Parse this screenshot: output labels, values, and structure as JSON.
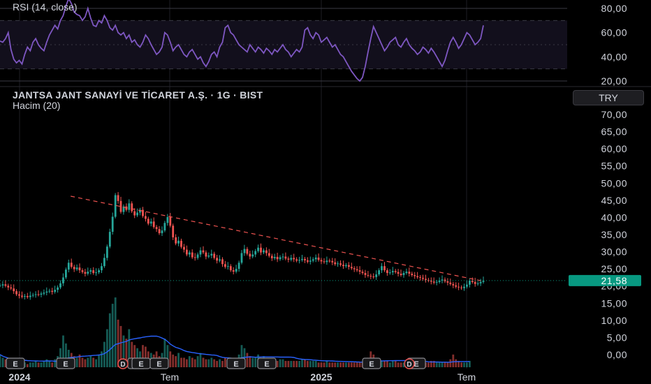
{
  "header": {
    "symbol_title": "JANTSA JANT SANAYİ VE TİCARET A.Ş. · 1G · BIST",
    "volume_label": "Hacim (20)",
    "rsi_label": "RSI (14, close)",
    "currency_button": "TRY"
  },
  "colors": {
    "background": "#000000",
    "rsi_line": "#7e57c2",
    "rsi_band": "#120f1c",
    "up": "#26a69a",
    "down": "#ef5350",
    "trendline": "#ef5350",
    "price_badge": "#089981",
    "volume_ma": "#2962ff"
  },
  "chart_data": [
    {
      "type": "line",
      "title": "RSI (14, close)",
      "yticks": [
        "80,00",
        "60,00",
        "40,00",
        "20,00"
      ],
      "ylim": [
        20,
        80
      ],
      "bands": [
        30,
        70
      ],
      "series": [
        {
          "values": [
            53,
            52,
            55,
            60,
            46,
            38,
            35,
            37,
            34,
            42,
            48,
            45,
            52,
            55,
            50,
            47,
            45,
            52,
            58,
            62,
            66,
            63,
            70,
            74,
            82,
            88,
            84,
            77,
            75,
            74,
            70,
            73,
            80,
            72,
            66,
            65,
            70,
            68,
            74,
            70,
            64,
            62,
            66,
            60,
            58,
            60,
            55,
            58,
            52,
            54,
            50,
            48,
            52,
            58,
            55,
            50,
            46,
            42,
            44,
            48,
            60,
            58,
            52,
            45,
            48,
            50,
            46,
            42,
            40,
            44,
            46,
            42,
            38,
            40,
            35,
            32,
            36,
            42,
            44,
            40,
            48,
            52,
            64,
            66,
            60,
            58,
            54,
            50,
            48,
            46,
            44,
            50,
            47,
            44,
            48,
            46,
            43,
            47,
            45,
            42,
            46,
            44,
            47,
            50,
            46,
            44,
            40,
            43,
            46,
            44,
            48,
            62,
            64,
            58,
            55,
            60,
            58,
            52,
            54,
            56,
            52,
            48,
            50,
            46,
            42,
            40,
            36,
            32,
            28,
            25,
            22,
            20,
            23,
            32,
            44,
            55,
            65,
            60,
            55,
            50,
            45,
            48,
            52,
            54,
            56,
            50,
            48,
            52,
            55,
            50,
            47,
            45,
            42,
            44,
            48,
            46,
            43,
            47,
            44,
            40,
            36,
            32,
            37,
            45,
            52,
            56,
            52,
            47,
            50,
            55,
            60,
            58,
            54,
            50,
            52,
            55,
            66
          ]
        }
      ]
    },
    {
      "type": "candlestick",
      "title": "JANTSA JANT SANAYİ VE TİCARET A.Ş. · 1G · BIST",
      "yticks": [
        "70,00",
        "65,00",
        "60,00",
        "55,00",
        "50,00",
        "45,00",
        "40,00",
        "35,00",
        "30,00",
        "25,00",
        "20,00",
        "15,00",
        "10,00",
        "5,00",
        "0,00"
      ],
      "ylim": [
        0,
        70
      ],
      "xticks": [
        "2024",
        "Tem",
        "2025",
        "Tem"
      ],
      "last_price": "21,58",
      "close": [
        20.2,
        20.5,
        20.1,
        19.6,
        19.3,
        18.5,
        17.6,
        17.2,
        16.9,
        17.1,
        16.8,
        17.2,
        17.4,
        17.6,
        17.5,
        17.8,
        18.1,
        18.4,
        18.6,
        18.3,
        18.9,
        19.6,
        20.8,
        22.5,
        24.8,
        26.8,
        25.6,
        24.9,
        25.4,
        24.6,
        24.1,
        23.6,
        24.2,
        24.6,
        23.8,
        24.0,
        24.6,
        25.8,
        28.2,
        31.5,
        35.8,
        40.2,
        46.5,
        44.8,
        41.6,
        43.2,
        42.2,
        44.1,
        41.8,
        40.6,
        41.4,
        42.2,
        40.4,
        39.6,
        38.2,
        38.8,
        37.2,
        36.6,
        35.4,
        36.2,
        38.4,
        40.1,
        37.6,
        34.2,
        32.4,
        33.2,
        31.4,
        30.6,
        29.2,
        29.8,
        28.4,
        28.2,
        29.2,
        30.4,
        29.8,
        28.6,
        28.9,
        29.4,
        28.2,
        27.4,
        27.8,
        26.4,
        25.6,
        25.8,
        24.6,
        24.2,
        25.0,
        26.8,
        29.6,
        30.8,
        29.4,
        28.6,
        29.2,
        30.2,
        31.2,
        29.8,
        30.4,
        29.6,
        28.8,
        28.1,
        28.5,
        27.8,
        28.4,
        28.6,
        28.0,
        27.7,
        28.2,
        27.8,
        27.4,
        27.6,
        27.9,
        27.5,
        27.1,
        27.4,
        27.8,
        28.3,
        27.6,
        27.2,
        27.0,
        27.4,
        27.3,
        26.9,
        26.4,
        26.6,
        26.2,
        25.8,
        26.1,
        25.6,
        25.2,
        24.9,
        24.6,
        24.2,
        23.8,
        23.2,
        23.0,
        22.8,
        22.6,
        23.4,
        24.6,
        25.8,
        24.6,
        23.8,
        24.0,
        24.4,
        24.1,
        23.6,
        23.2,
        23.8,
        24.2,
        23.6,
        23.2,
        22.9,
        22.6,
        22.4,
        22.1,
        21.8,
        21.6,
        21.3,
        21.0,
        21.2,
        21.6,
        21.9,
        21.4,
        21.0,
        20.6,
        20.2,
        19.8,
        19.6,
        19.4,
        19.8,
        20.4,
        21.6,
        21.2,
        20.6,
        20.8,
        21.2,
        21.58
      ],
      "trendline": [
        [
          46.5,
          41
        ],
        [
          21.4,
          176
        ]
      ],
      "earnings_markers": [
        "E",
        "E",
        "E",
        "E",
        "E",
        "E",
        "E",
        "E",
        "E"
      ],
      "dividend_markers": [
        "D",
        "D"
      ]
    },
    {
      "type": "bar",
      "title": "Hacim (20)",
      "values": [
        8,
        6,
        5,
        4,
        3,
        5,
        3,
        4,
        3,
        3,
        2,
        3,
        3,
        4,
        3,
        3,
        4,
        5,
        4,
        3,
        5,
        7,
        12,
        20,
        15,
        11,
        9,
        7,
        6,
        8,
        6,
        5,
        6,
        7,
        6,
        5,
        8,
        10,
        16,
        24,
        34,
        40,
        44,
        30,
        26,
        20,
        18,
        24,
        16,
        14,
        12,
        10,
        14,
        13,
        10,
        9,
        8,
        10,
        7,
        9,
        18,
        14,
        10,
        8,
        7,
        9,
        6,
        6,
        5,
        7,
        6,
        5,
        7,
        9,
        6,
        5,
        5,
        6,
        5,
        4,
        5,
        4,
        6,
        5,
        4,
        4,
        5,
        8,
        14,
        12,
        9,
        7,
        6,
        6,
        8,
        6,
        7,
        5,
        5,
        4,
        4,
        4,
        5,
        5,
        4,
        4,
        4,
        4,
        4,
        4,
        5,
        5,
        4,
        4,
        4,
        4,
        3,
        3,
        3,
        4,
        3,
        3,
        3,
        3,
        3,
        3,
        3,
        3,
        3,
        3,
        3,
        3,
        3,
        3,
        6,
        10,
        8,
        6,
        4,
        4,
        4,
        4,
        3,
        4,
        4,
        3,
        3,
        3,
        3,
        3,
        3,
        3,
        3,
        3,
        3,
        3,
        3,
        4,
        4,
        3,
        3,
        3,
        3,
        3,
        5,
        8,
        5,
        4,
        3,
        3,
        3,
        4
      ]
    }
  ]
}
